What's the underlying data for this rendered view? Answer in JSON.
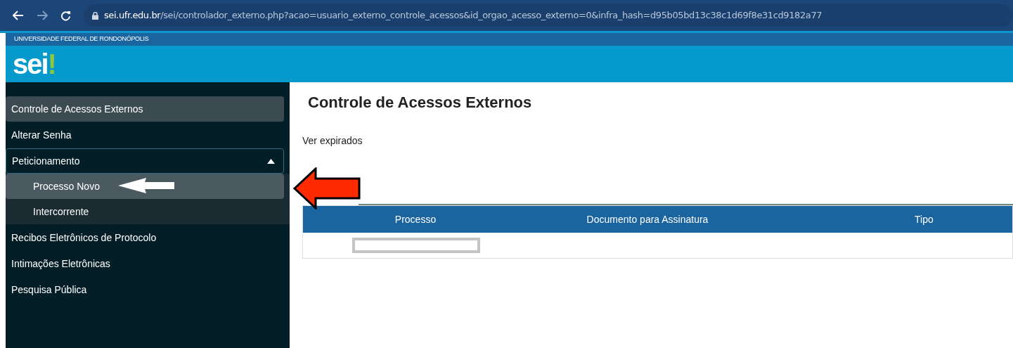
{
  "browser": {
    "url_host": "sei.ufr.edu.br",
    "url_path": "/sei/controlador_externo.php?acao=usuario_externo_controle_acessos&id_orgao_acesso_externo=0&infra_hash=d95b05bd13c38c1d69f8e31cd9182a77"
  },
  "header": {
    "org": "UNIVERSIDADE FEDERAL DE RONDONÓPOLIS",
    "logo": "sei!"
  },
  "sidebar": {
    "items": [
      {
        "label": "Controle de Acessos Externos",
        "selected": true
      },
      {
        "label": "Alterar Senha",
        "selected": false
      },
      {
        "label": "Peticionamento",
        "selected": false,
        "expanded": true,
        "children": [
          {
            "label": "Processo Novo",
            "selected": true
          },
          {
            "label": "Intercorrente",
            "selected": false
          }
        ]
      },
      {
        "label": "Recibos Eletrônicos de Protocolo",
        "selected": false
      },
      {
        "label": "Intimações Eletrônicas",
        "selected": false
      },
      {
        "label": "Pesquisa Pública",
        "selected": false
      }
    ]
  },
  "content": {
    "title": "Controle de Acessos Externos",
    "link": "Ver expirados",
    "table": {
      "columns": [
        "Processo",
        "Documento para Assinatura",
        "Tipo"
      ]
    }
  }
}
